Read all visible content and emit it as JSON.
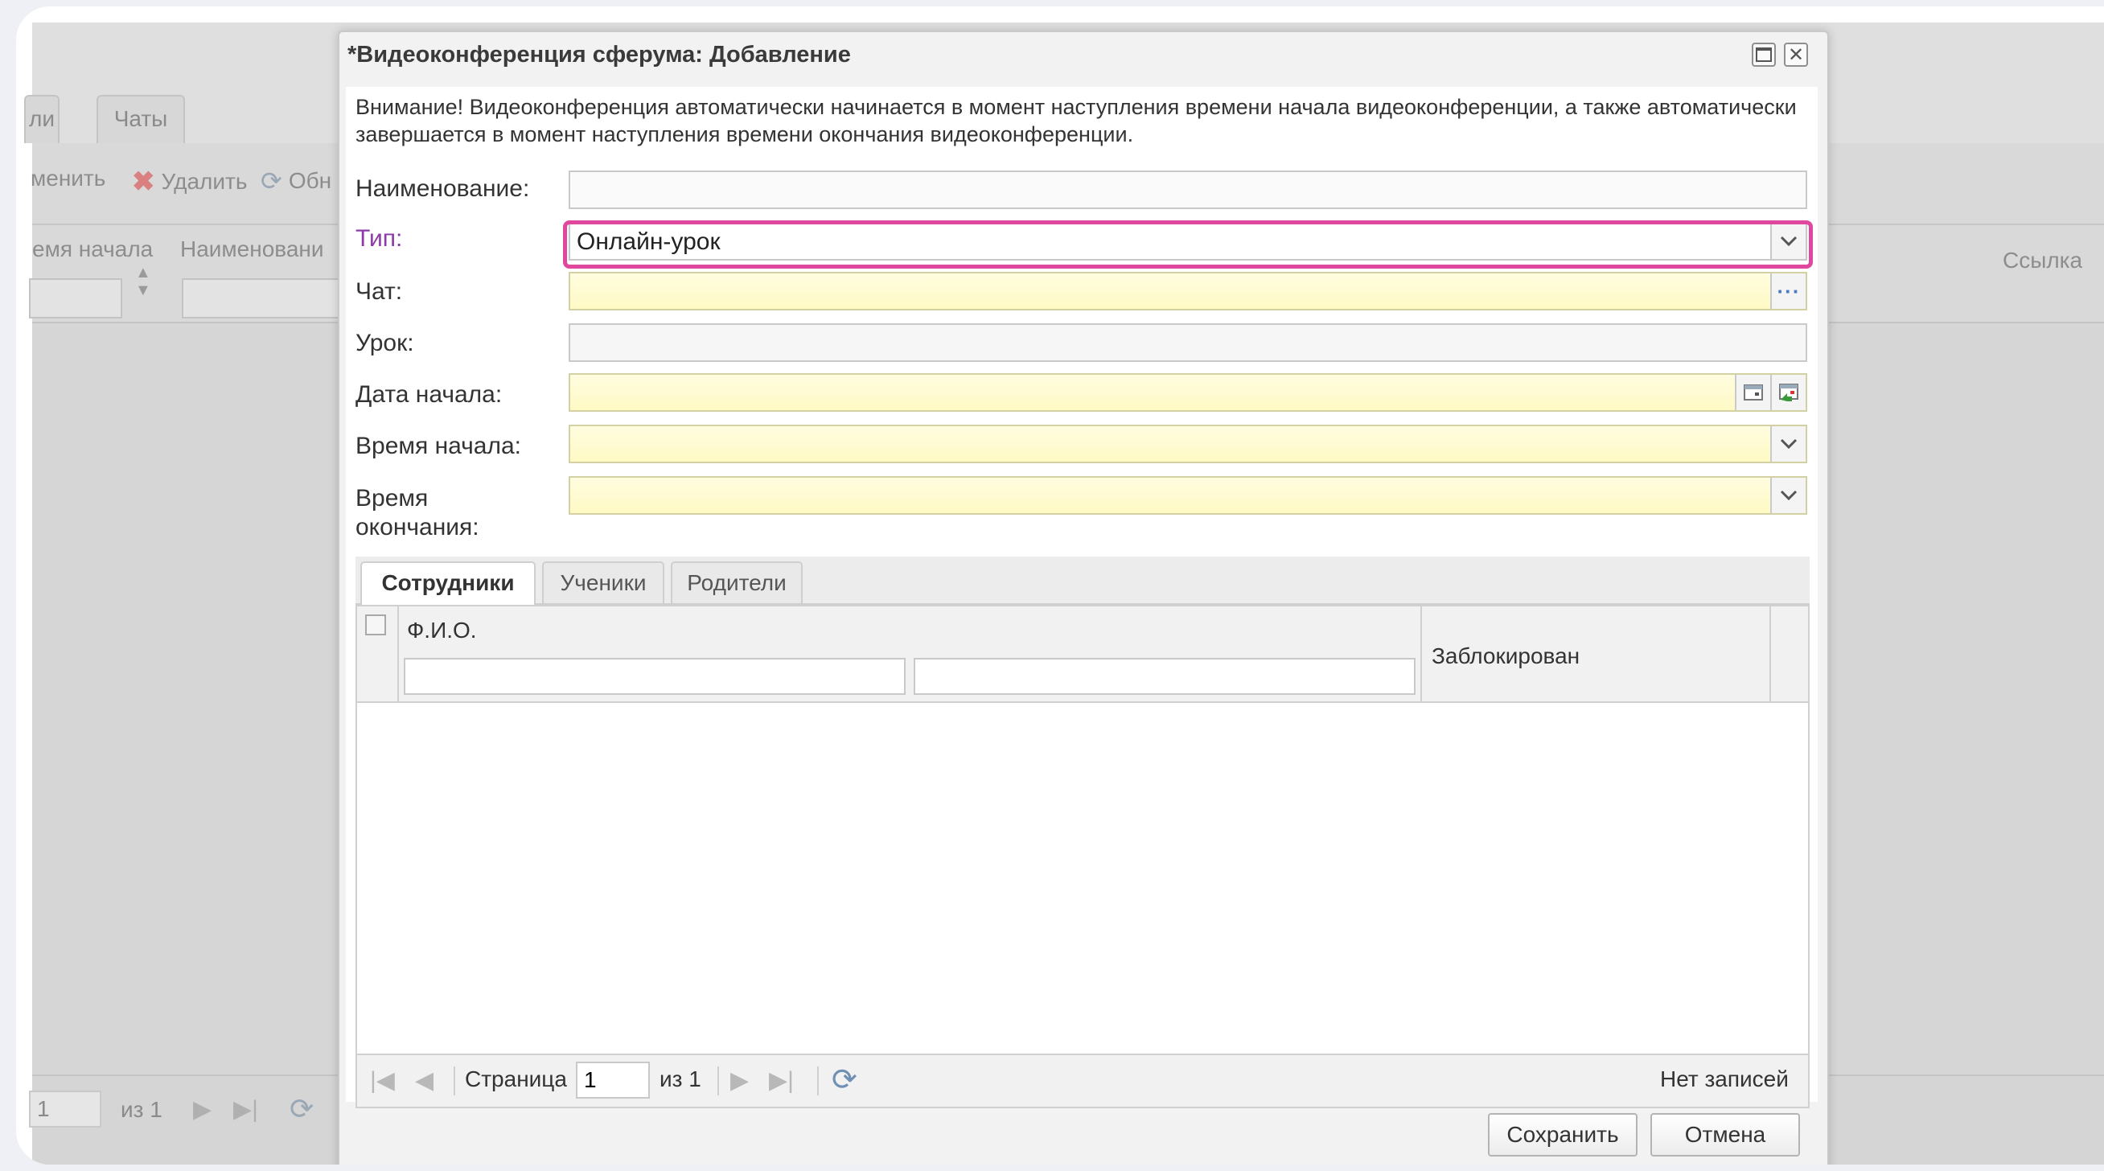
{
  "background": {
    "tab_partial": "ли",
    "tab_chats": "Чаты",
    "toolbar": {
      "edit": "менить",
      "delete": "Удалить",
      "refresh": "Обн"
    },
    "columns": {
      "start_time": "емя начала",
      "name": "Наименовани",
      "link": "Ссылка"
    },
    "pager": {
      "page_value": "1",
      "of": "из 1"
    }
  },
  "dialog": {
    "title": "*Видеоконференция сферума: Добавление",
    "notice": "Внимание! Видеоконференция автоматически начинается в момент наступления времени начала видеоконференции, а также автоматически завершается в момент наступления времени окончания видеоконференции.",
    "fields": {
      "name_label": "Наименование:",
      "name_value": "",
      "type_label": "Тип:",
      "type_value": "Онлайн-урок",
      "chat_label": "Чат:",
      "chat_value": "",
      "lesson_label": "Урок:",
      "lesson_value": "",
      "start_date_label": "Дата начала:",
      "start_date_value": "",
      "start_time_label": "Время начала:",
      "start_time_value": "",
      "end_time_label_line1": "Время",
      "end_time_label_line2": "окончания:",
      "end_time_value": ""
    },
    "tabs": [
      "Сотрудники",
      "Ученики",
      "Родители"
    ],
    "grid": {
      "col_fio": "Ф.И.О.",
      "col_blocked": "Заблокирован"
    },
    "pager": {
      "page_label": "Страница",
      "page_value": "1",
      "of": "из 1",
      "status": "Нет записей"
    },
    "buttons": {
      "save": "Сохранить",
      "cancel": "Отмена"
    },
    "accent_color": "#e0479e",
    "required_field_color": "#fff9c4"
  }
}
